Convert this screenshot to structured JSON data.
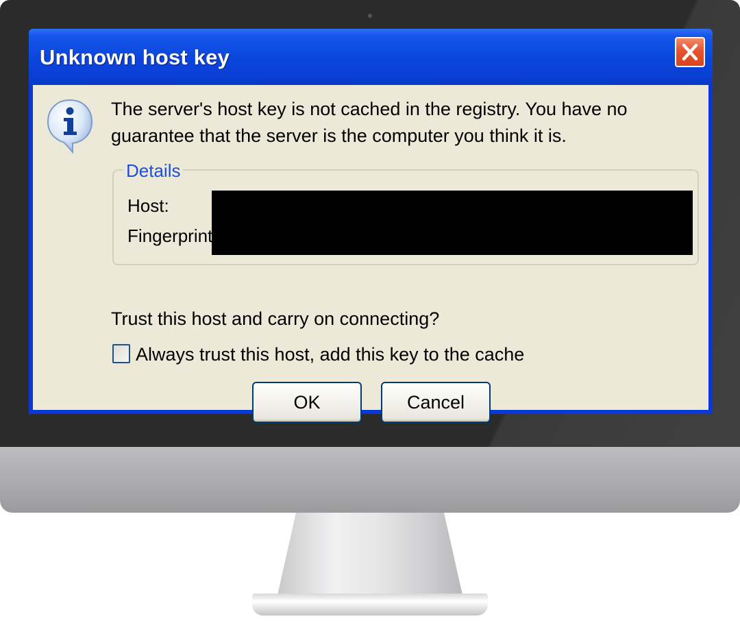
{
  "dialog": {
    "title": "Unknown host key",
    "message": "The server's host key is not cached in the registry. You have no guarantee that the server is the computer you think it is.",
    "details": {
      "legend": "Details",
      "host_label": "Host:",
      "fingerprint_label": "Fingerprint:"
    },
    "question": "Trust this host and carry on connecting?",
    "checkbox_label": "Always trust this host, add this key to the cache",
    "checkbox_checked": false,
    "ok_label": "OK",
    "cancel_label": "Cancel"
  },
  "icons": {
    "close": "close-icon",
    "info": "info-icon"
  },
  "colors": {
    "titlebar": "#0a45dc",
    "client": "#ece9d8",
    "legend_text": "#1d4fd8",
    "close_button": "#e5532e"
  }
}
